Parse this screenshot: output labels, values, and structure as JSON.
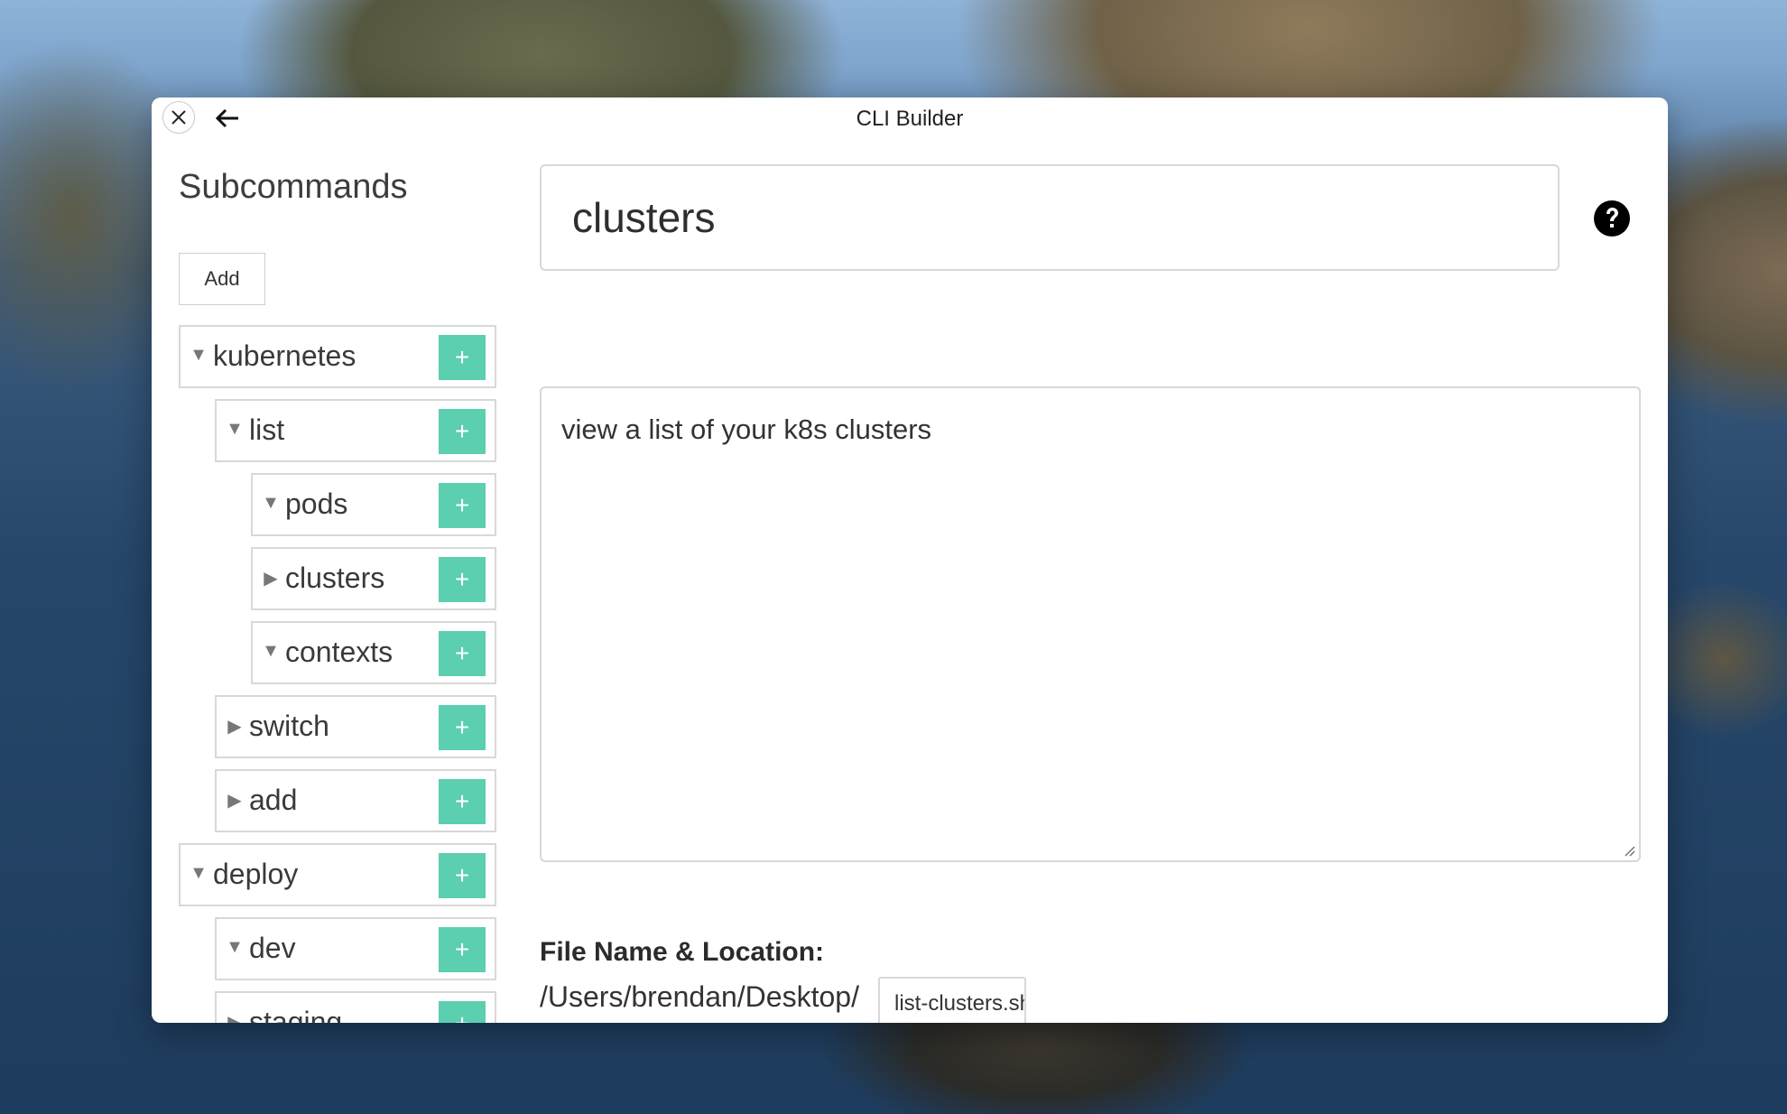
{
  "window": {
    "title": "CLI Builder"
  },
  "icons": {
    "close": "close-icon",
    "back": "arrow-left-icon",
    "help": "question-circle-icon",
    "expanded": "triangle-down-icon",
    "collapsed": "triangle-right-icon",
    "plus": "plus-icon"
  },
  "colors": {
    "plus_button": "#5bcfb0",
    "border": "#d8d8d8"
  },
  "sidebar": {
    "title": "Subcommands",
    "add_label": "Add",
    "tree": [
      {
        "label": "kubernetes",
        "arrow": "▼",
        "plus": "+"
      },
      {
        "label": "list",
        "arrow": "▼",
        "plus": "+"
      },
      {
        "label": "pods",
        "arrow": "▼",
        "plus": "+"
      },
      {
        "label": "clusters",
        "arrow": "▶",
        "plus": "+"
      },
      {
        "label": "contexts",
        "arrow": "▼",
        "plus": "+"
      },
      {
        "label": "switch",
        "arrow": "▶",
        "plus": "+"
      },
      {
        "label": "add",
        "arrow": "▶",
        "plus": "+"
      },
      {
        "label": "deploy",
        "arrow": "▼",
        "plus": "+"
      },
      {
        "label": "dev",
        "arrow": "▼",
        "plus": "+"
      },
      {
        "label": "staging",
        "arrow": "▶",
        "plus": "+"
      }
    ]
  },
  "editor": {
    "name_value": "clusters",
    "description_value": "view a list of your k8s clusters",
    "file_label": "File Name & Location:",
    "file_path": "/Users/brendan/Desktop/",
    "file_name_value": "list-clusters.sh"
  }
}
